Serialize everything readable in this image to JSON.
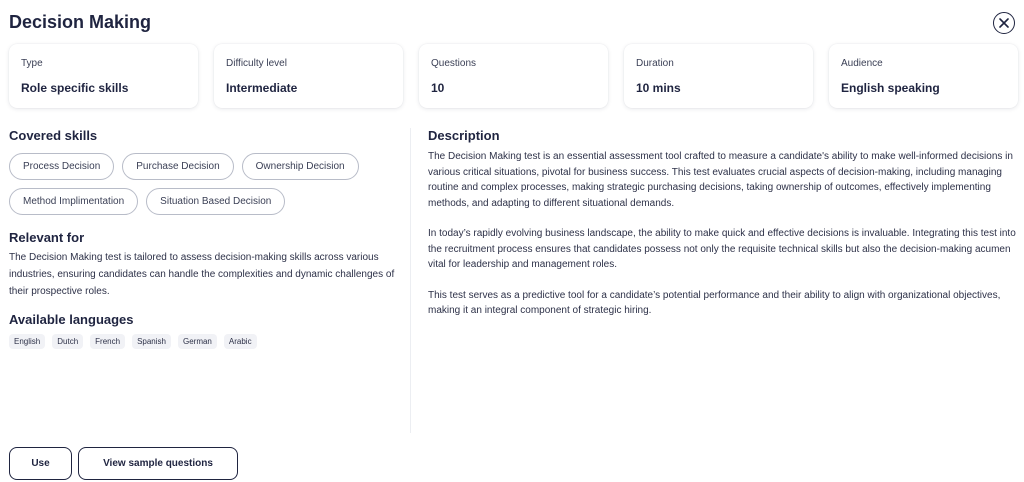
{
  "header": {
    "title": "Decision Making"
  },
  "info_cards": [
    {
      "label": "Type",
      "value": "Role specific skills"
    },
    {
      "label": "Difficulty level",
      "value": "Intermediate"
    },
    {
      "label": "Questions",
      "value": "10"
    },
    {
      "label": "Duration",
      "value": "10 mins"
    },
    {
      "label": "Audience",
      "value": "English speaking"
    }
  ],
  "covered_skills": {
    "heading": "Covered skills",
    "items": [
      "Process Decision",
      "Purchase Decision",
      "Ownership Decision",
      "Method Implimentation",
      "Situation Based Decision"
    ]
  },
  "relevant_for": {
    "heading": "Relevant for",
    "text": "The Decision Making test is tailored to assess decision-making skills across various industries, ensuring candidates can handle the complexities and dynamic challenges of their prospective roles."
  },
  "available_languages": {
    "heading": "Available languages",
    "items": [
      "English",
      "Dutch",
      "French",
      "Spanish",
      "German",
      "Arabic"
    ]
  },
  "description": {
    "heading": "Description",
    "paragraphs": [
      "The Decision Making test is an essential assessment tool crafted to measure a candidate's ability to make well-informed decisions in various critical situations, pivotal for business success. This test evaluates crucial aspects of decision-making, including managing routine and complex processes, making strategic purchasing decisions, taking ownership of outcomes, effectively implementing methods, and adapting to different situational demands.",
      "In today’s rapidly evolving business landscape, the ability to make quick and effective decisions is invaluable. Integrating this test into the recruitment process ensures that candidates possess not only the requisite technical skills but also the decision-making acumen vital for leadership and management roles.",
      "This test serves as a predictive tool for a candidate’s potential performance and their ability to align with organizational objectives, making it an integral component of strategic hiring."
    ]
  },
  "footer": {
    "use_label": "Use",
    "sample_label": "View sample questions"
  }
}
